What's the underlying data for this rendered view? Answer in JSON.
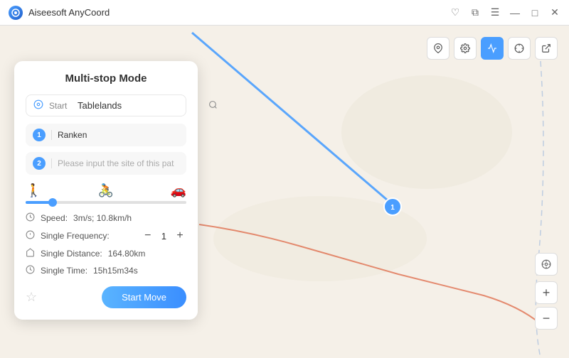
{
  "app": {
    "title": "Aiseesoft AnyCoord",
    "logo_text": "A"
  },
  "titlebar": {
    "controls": [
      "favorite-icon",
      "restore-icon",
      "menu-icon",
      "minimize-icon",
      "maximize-icon",
      "close-icon"
    ]
  },
  "panel": {
    "title": "Multi-stop Mode",
    "start_label": "Start",
    "start_value": "Tablelands",
    "start_placeholder": "Tablelands",
    "stops": [
      {
        "num": "1",
        "value": "Ranken",
        "placeholder": ""
      },
      {
        "num": "2",
        "value": "",
        "placeholder": "Please input the site of this pat"
      }
    ],
    "speed_label": "Speed:",
    "speed_value": "3m/s; 10.8km/h",
    "frequency_label": "Single Frequency:",
    "frequency_value": "1",
    "distance_label": "Single Distance:",
    "distance_value": "164.80km",
    "time_label": "Single Time:",
    "time_value": "15h15m34s",
    "start_button": "Start Move"
  },
  "toolbar": {
    "buttons": [
      {
        "id": "pin",
        "label": "📍",
        "active": false
      },
      {
        "id": "settings",
        "label": "⚙",
        "active": false
      },
      {
        "id": "route",
        "label": "🗺",
        "active": true
      },
      {
        "id": "crosshair",
        "label": "⊕",
        "active": false
      },
      {
        "id": "export",
        "label": "↗",
        "active": false
      }
    ]
  },
  "map": {
    "marker_label": "1"
  }
}
